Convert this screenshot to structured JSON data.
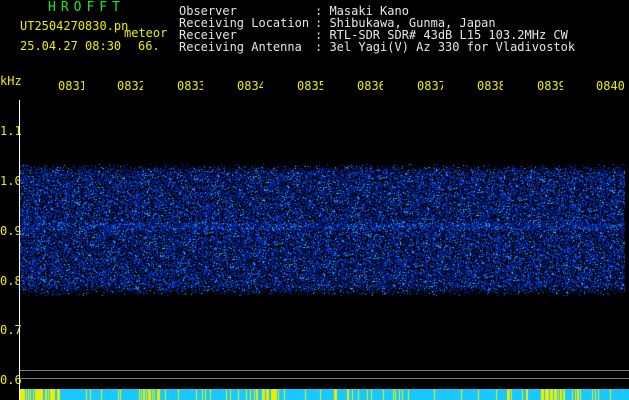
{
  "header": {
    "app_title": "HROFFT",
    "file_name": "UT2504270830.pn",
    "meteor_label": "meteor",
    "date_time": "25.04.27 08:30",
    "count": "66."
  },
  "station_info": [
    {
      "label": "Observer",
      "value": ": Masaki Kano"
    },
    {
      "label": "Receiving Location",
      "value": ": Shibukawa, Gunma, Japan"
    },
    {
      "label": "Receiver",
      "value": ": RTL-SDR SDR# 43dB L15 103.2MHz CW"
    },
    {
      "label": "Receiving Antenna",
      "value": ": 3el Yagi(V) Az 330 for Vladivostok"
    }
  ],
  "axis": {
    "unit_label": "kHz",
    "time_ticks": [
      "0831",
      "0832",
      "0833",
      "0834",
      "0835",
      "0836",
      "0837",
      "0838",
      "0839",
      "0840"
    ],
    "freq_ticks": [
      "1.1",
      "1.0",
      "0.9",
      "0.8",
      "0.7",
      "0.6"
    ]
  },
  "colors": {
    "label_green": "#19e61c",
    "tick_yellow": "#eded00",
    "signal_blue": "#1e3cff",
    "bar_cyan": "#19c8ff"
  }
}
